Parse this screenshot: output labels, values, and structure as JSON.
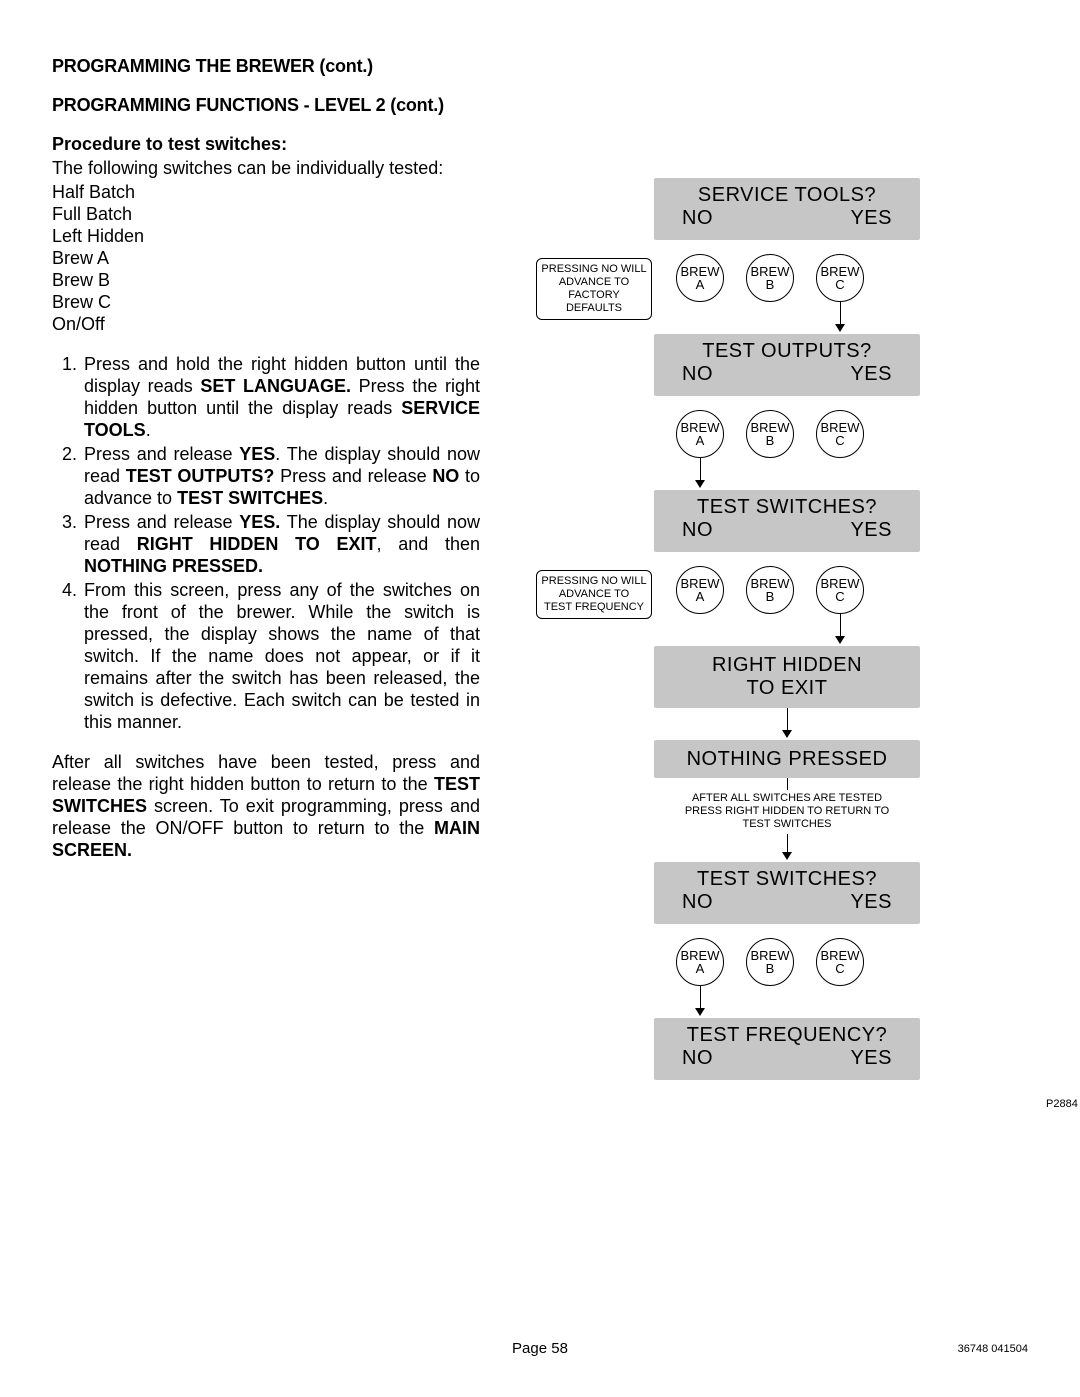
{
  "headings": {
    "h1": "PROGRAMMING THE BREWER (cont.)",
    "h2": "PROGRAMMING FUNCTIONS - LEVEL  2 (cont.)",
    "h3": "Procedure to test switches:"
  },
  "intro": "The following switches can be individually tested:",
  "switches": [
    "Half Batch",
    "Full Batch",
    "Left Hidden",
    "Brew A",
    "Brew B",
    "Brew C",
    "On/Off"
  ],
  "steps": {
    "s1a": "Press and hold the right hidden button until the display reads ",
    "s1b": "SET LANGUAGE.",
    "s1c": "  Press the right hidden button until the display reads ",
    "s1d": "SERVICE TOOLS",
    "s1e": ".",
    "s2a": "Press and release ",
    "s2b": "YES",
    "s2c": ".  The display should now read ",
    "s2d": "TEST OUTPUTS?",
    "s2e": "  Press and release ",
    "s2f": "NO",
    "s2g": " to advance to ",
    "s2h": "TEST SWITCHES",
    "s2i": ".",
    "s3a": "Press and release ",
    "s3b": "YES.",
    "s3c": "  The display should now read ",
    "s3d": "RIGHT HIDDEN TO EXIT",
    "s3e": ", and then ",
    "s3f": "NOTHING PRESSED.",
    "s4": "From this screen, press any of the switches on the front of the brewer.  While the switch is pressed, the display shows the name of that switch.  If the name does not appear, or if it remains after the switch has been released, the switch is defective.  Each switch can be tested in this manner."
  },
  "after": {
    "a1": "After all switches have been tested, press and release the right hidden button to return to the ",
    "a2": "TEST SWITCHES",
    "a3": " screen. To exit programming, press and release the ON/OFF button to return to the ",
    "a4": "MAIN SCREEN."
  },
  "flow": {
    "brew_a_top": "BREW",
    "brew_a_bot": "A",
    "brew_b_top": "BREW",
    "brew_b_bot": "B",
    "brew_c_top": "BREW",
    "brew_c_bot": "C",
    "no": "NO",
    "yes": "YES",
    "service_tools": "SERVICE TOOLS?",
    "test_outputs": "TEST OUTPUTS?",
    "test_switches": "TEST SWITCHES?",
    "right_hidden": "RIGHT HIDDEN",
    "to_exit": "TO EXIT",
    "nothing_pressed": "NOTHING PRESSED",
    "test_frequency": "TEST FREQUENCY?",
    "note1_l1": "PRESSING NO WILL",
    "note1_l2": "ADVANCE TO",
    "note1_l3": "FACTORY DEFAULTS",
    "note2_l1": "PRESSING NO WILL",
    "note2_l2": "ADVANCE TO",
    "note2_l3": "TEST FREQUENCY",
    "tiny_l1": "AFTER ALL SWITCHES ARE TESTED",
    "tiny_l2": "PRESS RIGHT HIDDEN TO RETURN TO",
    "tiny_l3": "TEST SWITCHES",
    "fig_code": "P2884"
  },
  "footer": {
    "page": "Page 58",
    "doc": "36748 041504"
  }
}
